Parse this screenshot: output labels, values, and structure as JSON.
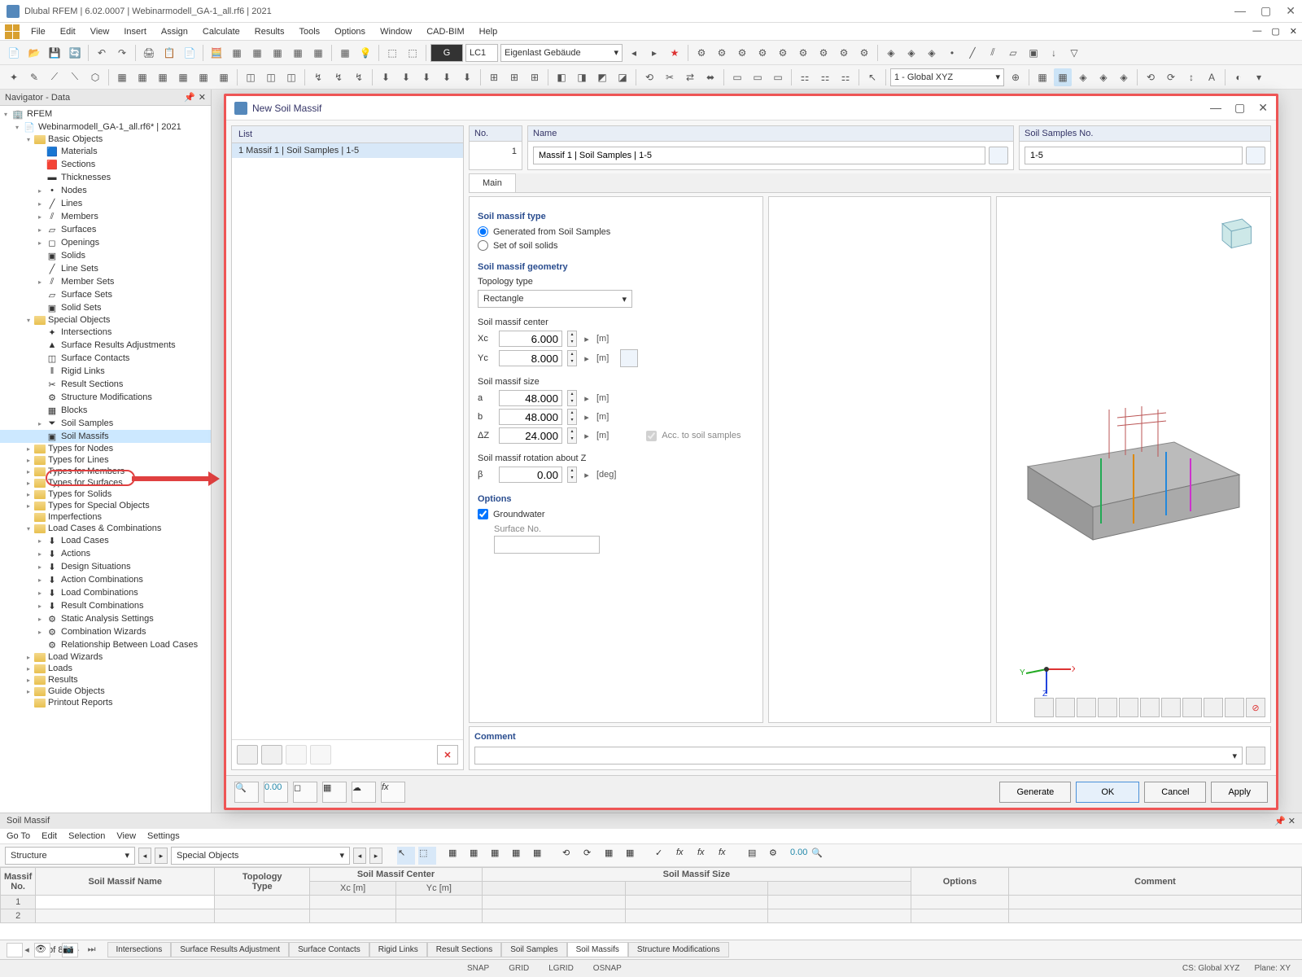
{
  "window": {
    "title": "Dlubal RFEM | 6.02.0007 | Webinarmodell_GA-1_all.rf6 | 2021",
    "min": "—",
    "max": "▢",
    "close": "✕"
  },
  "menu": [
    "File",
    "Edit",
    "View",
    "Insert",
    "Assign",
    "Calculate",
    "Results",
    "Tools",
    "Options",
    "Window",
    "CAD-BIM",
    "Help"
  ],
  "toolbar1": {
    "lc_badge": "G",
    "lc_code": "LC1",
    "lc_name": "Eigenlast Gebäude",
    "coords": "1 - Global XYZ"
  },
  "navigator": {
    "title": "Navigator - Data",
    "root": "RFEM",
    "project": "Webinarmodell_GA-1_all.rf6* | 2021",
    "basic": "Basic Objects",
    "basic_items": [
      "Materials",
      "Sections",
      "Thicknesses",
      "Nodes",
      "Lines",
      "Members",
      "Surfaces",
      "Openings",
      "Solids",
      "Line Sets",
      "Member Sets",
      "Surface Sets",
      "Solid Sets"
    ],
    "special": "Special Objects",
    "special_items": [
      "Intersections",
      "Surface Results Adjustments",
      "Surface Contacts",
      "Rigid Links",
      "Result Sections",
      "Structure Modifications",
      "Blocks",
      "Soil Samples",
      "Soil Massifs"
    ],
    "types": [
      "Types for Nodes",
      "Types for Lines",
      "Types for Members",
      "Types for Surfaces",
      "Types for Solids",
      "Types for Special Objects"
    ],
    "imperfections": "Imperfections",
    "loadcases": "Load Cases & Combinations",
    "lc_items": [
      "Load Cases",
      "Actions",
      "Design Situations",
      "Action Combinations",
      "Load Combinations",
      "Result Combinations",
      "Static Analysis Settings",
      "Combination Wizards",
      "Relationship Between Load Cases"
    ],
    "tail": [
      "Load Wizards",
      "Loads",
      "Results",
      "Guide Objects",
      "Printout Reports"
    ]
  },
  "dialog": {
    "title": "New Soil Massif",
    "list_header": "List",
    "list_row": "1  Massif 1 | Soil Samples | 1-5",
    "no_header": "No.",
    "no_value": "1",
    "name_header": "Name",
    "name_value": "Massif 1 | Soil Samples | 1-5",
    "samples_header": "Soil Samples No.",
    "samples_value": "1-5",
    "tab_main": "Main",
    "sect_type": "Soil massif type",
    "radio1": "Generated from Soil Samples",
    "radio2": "Set of soil solids",
    "sect_geom": "Soil massif geometry",
    "topology_label": "Topology type",
    "topology_value": "Rectangle",
    "center_label": "Soil massif center",
    "xc_label": "Xc",
    "xc_value": "6.000",
    "xc_unit": "[m]",
    "yc_label": "Yc",
    "yc_value": "8.000",
    "yc_unit": "[m]",
    "size_label": "Soil massif size",
    "a_label": "a",
    "a_value": "48.000",
    "a_unit": "[m]",
    "b_label": "b",
    "b_value": "48.000",
    "b_unit": "[m]",
    "dz_label": "ΔZ",
    "dz_value": "24.000",
    "dz_unit": "[m]",
    "acc_label": "Acc. to soil samples",
    "rot_label": "Soil massif rotation about Z",
    "beta_label": "β",
    "beta_value": "0.00",
    "beta_unit": "[deg]",
    "sect_options": "Options",
    "groundwater": "Groundwater",
    "surface_no": "Surface No.",
    "comment": "Comment",
    "generate": "Generate",
    "ok": "OK",
    "cancel": "Cancel",
    "apply": "Apply"
  },
  "bottom": {
    "title": "Soil Massif",
    "menu": [
      "Go To",
      "Edit",
      "Selection",
      "View",
      "Settings"
    ],
    "combo1": "Structure",
    "combo2": "Special Objects",
    "cols": {
      "massif_no": "Massif\nNo.",
      "name": "Soil Massif Name",
      "topology": "Topology\nType",
      "center": "Soil Massif Center",
      "xc": "Xc [m]",
      "yc": "Yc [m]",
      "size": "Soil Massif Size",
      "options": "Options",
      "comment": "Comment"
    },
    "rows": [
      "1",
      "2"
    ],
    "pager": "7 of 8",
    "tabs": [
      "Intersections",
      "Surface Results Adjustment",
      "Surface Contacts",
      "Rigid Links",
      "Result Sections",
      "Soil Samples",
      "Soil Massifs",
      "Structure Modifications"
    ]
  },
  "status": {
    "snap": "SNAP",
    "grid": "GRID",
    "lgrid": "LGRID",
    "osnap": "OSNAP",
    "cs": "CS: Global XYZ",
    "plane": "Plane: XY"
  }
}
